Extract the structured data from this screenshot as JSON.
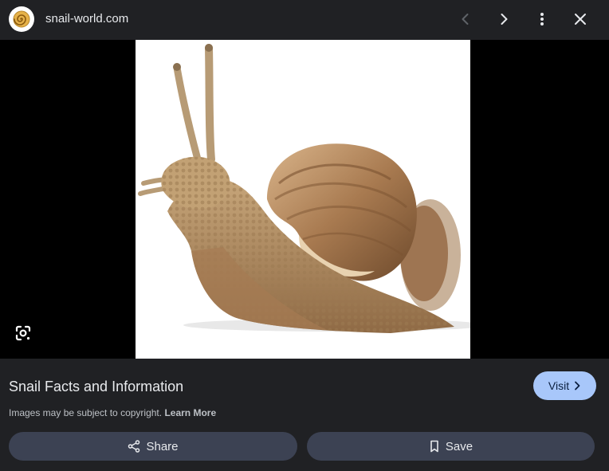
{
  "header": {
    "site_name": "snail-world.com",
    "favicon_icon": "snail-shell-icon",
    "prev_icon": "chevron-left-icon",
    "next_icon": "chevron-right-icon",
    "more_icon": "more-vert-icon",
    "close_icon": "close-icon"
  },
  "stage": {
    "image_subject": "snail",
    "lens_icon": "google-lens-icon"
  },
  "info": {
    "title": "Snail Facts and Information",
    "visit_label": "Visit",
    "copyright_text": "Images may be subject to copyright.",
    "learn_more_label": "Learn More"
  },
  "actions": {
    "share_label": "Share",
    "save_label": "Save"
  },
  "colors": {
    "background": "#202124",
    "stage": "#000000",
    "visit_button": "#a8c7fa",
    "action_button": "#3c4253",
    "text": "#e8eaed"
  }
}
